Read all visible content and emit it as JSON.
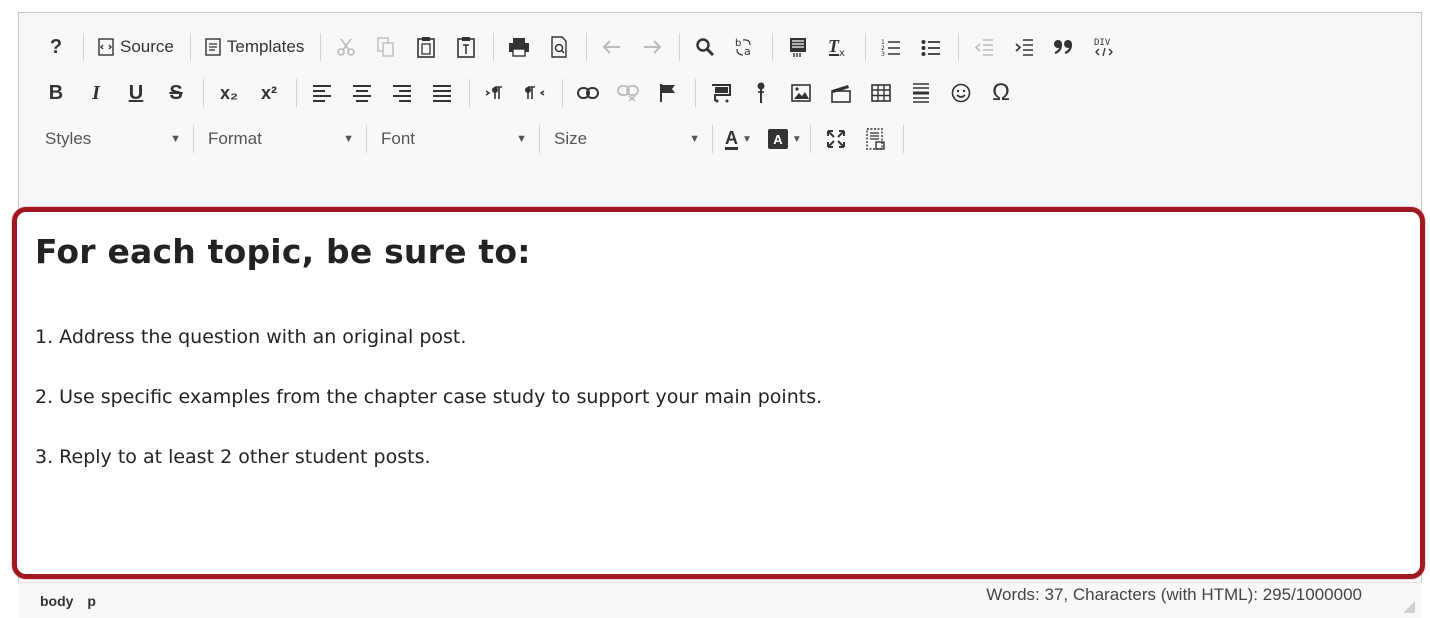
{
  "toolbar": {
    "row1": {
      "help": "?",
      "source_label": "Source",
      "templates_label": "Templates"
    },
    "row2": {
      "bold": "B",
      "italic": "I",
      "underline": "U",
      "strike": "S",
      "subscript": "x₂",
      "superscript": "x²",
      "omega": "Ω"
    },
    "row3": {
      "styles": "Styles",
      "format": "Format",
      "font": "Font",
      "size": "Size",
      "text_color_letter": "A",
      "bg_color_letter": "A"
    }
  },
  "content": {
    "heading": "For each topic, be sure to:",
    "items": [
      "1. Address the question with an original post.",
      "2. Use specific examples from the chapter case study to support your main points.",
      "3. Reply to at least 2 other student posts."
    ]
  },
  "statusbar": {
    "path": [
      "body",
      "p"
    ],
    "counter": "Words: 37, Characters (with HTML): 295/1000000"
  },
  "colors": {
    "highlight_border": "#a01820",
    "toolbar_bg": "#f8f8f8"
  }
}
